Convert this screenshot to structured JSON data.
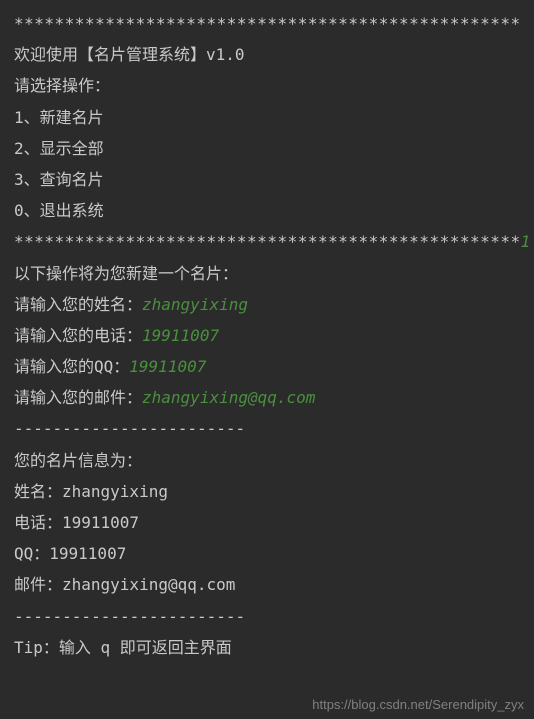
{
  "separator_top": "**************************************************",
  "welcome": "欢迎使用【名片管理系统】v1.0",
  "blank": "",
  "prompt_select": "请选择操作：",
  "menu": {
    "item1": "1、新建名片",
    "item2": "2、显示全部",
    "item3": "3、查询名片",
    "item0": "0、退出系统"
  },
  "separator_bottom": "**************************************************",
  "choice_input": "1",
  "create_intro": "以下操作将为您新建一个名片：",
  "prompts": {
    "name_label": "请输入您的姓名：",
    "name_value": "zhangyixing",
    "phone_label": "请输入您的电话：",
    "phone_value": "19911007",
    "qq_label": "请输入您的QQ：",
    "qq_value": "19911007",
    "email_label": "请输入您的邮件：",
    "email_value": "zhangyixing@qq.com"
  },
  "dash_line": "------------------------",
  "card_info_header": "您的名片信息为：",
  "card": {
    "name_line": "姓名：zhangyixing",
    "phone_line": "电话：19911007",
    "qq_line": "QQ：19911007",
    "email_line": "邮件：zhangyixing@qq.com"
  },
  "tip": "Tip：输入 q 即可返回主界面",
  "watermark": "https://blog.csdn.net/Serendipity_zyx"
}
